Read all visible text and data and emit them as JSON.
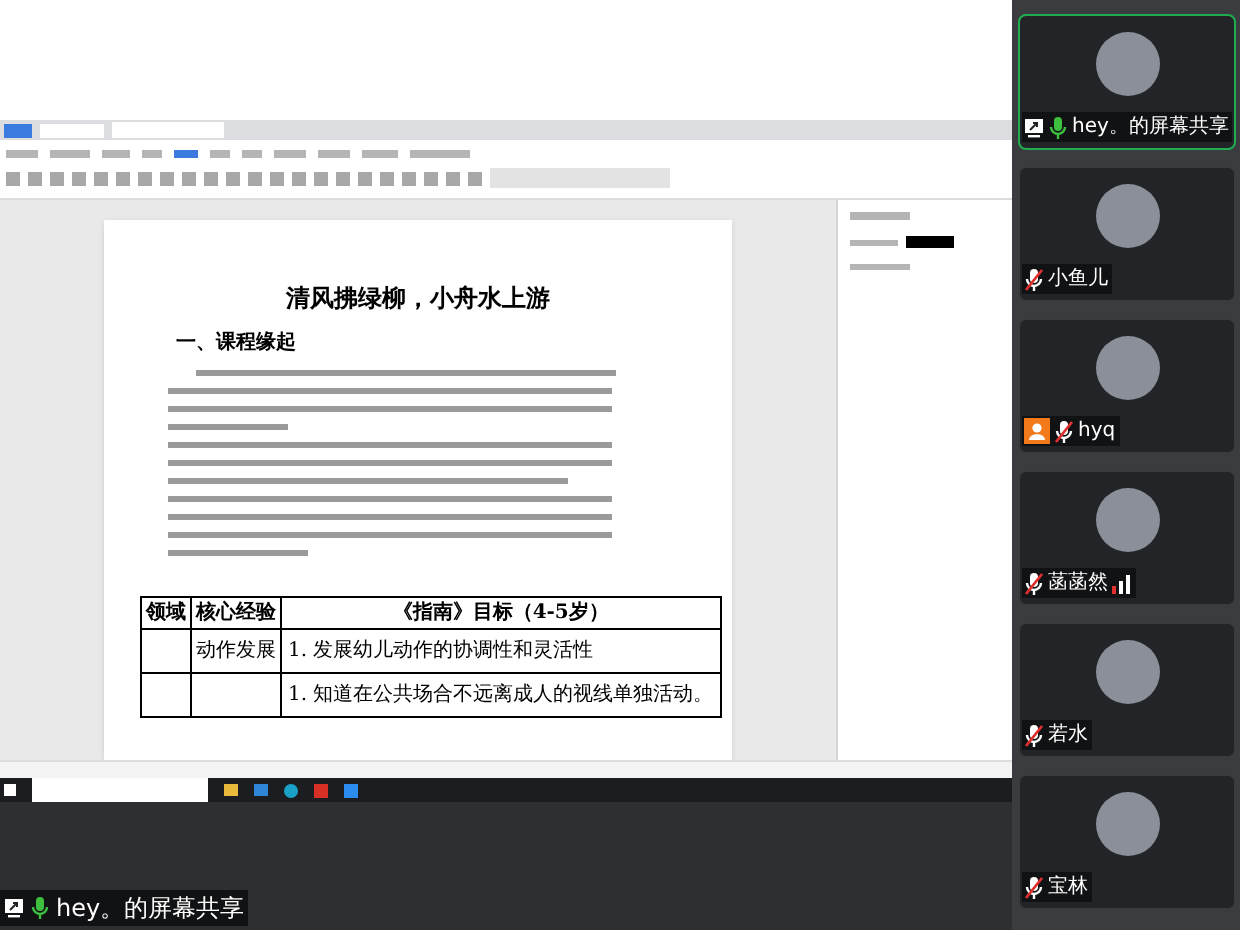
{
  "shared_screen": {
    "document": {
      "title": "清风拂绿柳，小舟水上游",
      "heading": "一、课程缘起",
      "table": {
        "columns": [
          "领域",
          "核心经验",
          "《指南》目标（4-5岁）"
        ],
        "rows": [
          {
            "experience": "动作发展",
            "goal": "1. 发展幼儿动作的协调性和灵活性"
          },
          {
            "goal": "1. 知道在公共场合不远离成人的视线单独活动。"
          }
        ]
      }
    }
  },
  "share_label": "hey。的屏幕共享",
  "participants": [
    {
      "name": "hey。的屏幕共享",
      "selected": true,
      "muted": false,
      "sharing": true,
      "host": false,
      "signal": false
    },
    {
      "name": "小鱼儿",
      "selected": false,
      "muted": true,
      "sharing": false,
      "host": false,
      "signal": false
    },
    {
      "name": "hyq",
      "selected": false,
      "muted": true,
      "sharing": false,
      "host": true,
      "signal": false
    },
    {
      "name": "菡菡然",
      "selected": false,
      "muted": true,
      "sharing": false,
      "host": false,
      "signal": true
    },
    {
      "name": "若水",
      "selected": false,
      "muted": true,
      "sharing": false,
      "host": false,
      "signal": false
    },
    {
      "name": "宝林",
      "selected": false,
      "muted": true,
      "sharing": false,
      "host": false,
      "signal": false
    }
  ]
}
